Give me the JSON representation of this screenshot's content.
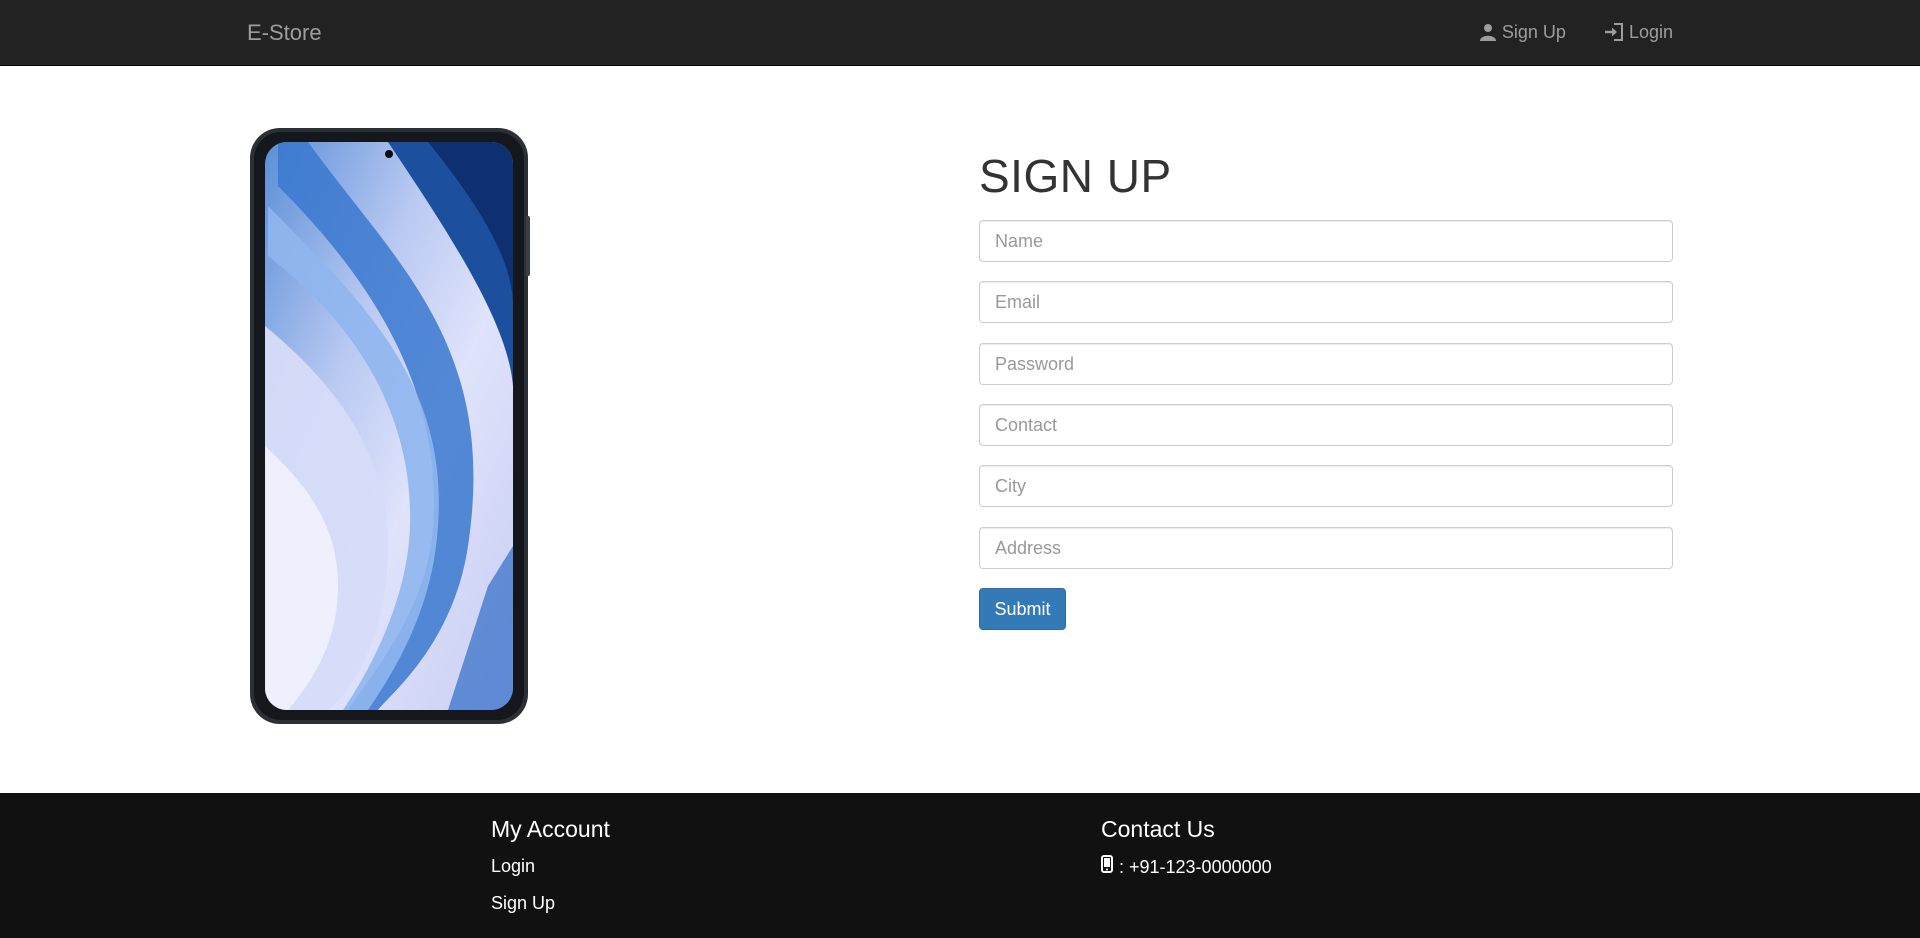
{
  "navbar": {
    "brand": "E-Store",
    "signup_label": "Sign Up",
    "login_label": "Login"
  },
  "signup_form": {
    "title": "SIGN UP",
    "fields": {
      "name": "Name",
      "email": "Email",
      "password": "Password",
      "contact": "Contact",
      "city": "City",
      "address": "Address"
    },
    "submit_label": "Submit"
  },
  "footer": {
    "account_heading": "My Account",
    "login_link": "Login",
    "signup_link": "Sign Up",
    "contact_heading": "Contact Us",
    "phone": ": +91-123-0000000"
  },
  "icons": {
    "signup": "user-icon",
    "login": "log-in-icon",
    "phone": "phone-icon"
  },
  "colors": {
    "navbar_bg": "#222222",
    "footer_bg": "#111111",
    "primary_button": "#337ab7",
    "nav_text": "#9d9d9d"
  }
}
